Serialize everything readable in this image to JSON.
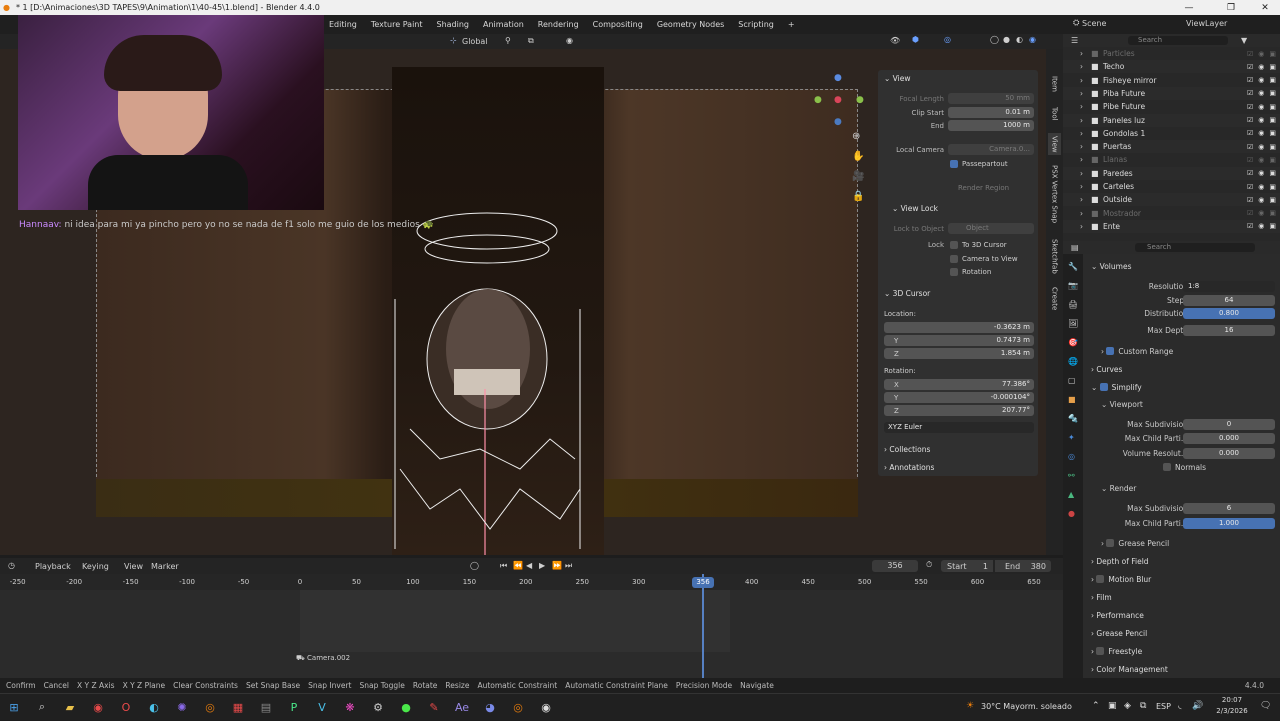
{
  "window": {
    "title": "* 1 [D:\\Animaciones\\3D TAPES\\9\\Animation\\1\\40-45\\1.blend] - Blender 4.4.0"
  },
  "menubar": {
    "workspaces": [
      "Editing",
      "Texture Paint",
      "Shading",
      "Animation",
      "Rendering",
      "Compositing",
      "Geometry Nodes",
      "Scripting"
    ],
    "add": "+"
  },
  "viewport_header": {
    "orientation": "Global"
  },
  "chat": {
    "user": "Hannaav:",
    "message": "ni idea para mi ya pincho pero yo no se nada de f1 solo me guio de los medios",
    "emoji": "🐢"
  },
  "npanel": {
    "view_header": "View",
    "focal_length_label": "Focal Length",
    "focal_length": "50 mm",
    "clip_start_label": "Clip Start",
    "clip_start": "0.01 m",
    "end_label": "End",
    "clip_end": "1000 m",
    "local_camera_label": "Local Camera",
    "local_camera": "Camera.0...",
    "passepartout": "Passepartout",
    "render_region": "Render Region",
    "view_lock_header": "View Lock",
    "lock_to_object_label": "Lock to Object",
    "lock_to_object": "Object",
    "lock_label": "Lock",
    "lock_cursor": "To 3D Cursor",
    "lock_camera": "Camera to View",
    "lock_rotation": "Rotation",
    "cursor_header": "3D Cursor",
    "location_label": "Location:",
    "loc_x": "-0.3623 m",
    "loc_y": "0.7473 m",
    "loc_z": "1.854 m",
    "rotation_label": "Rotation:",
    "rot_x": "77.386°",
    "rot_y": "-0.000104°",
    "rot_z": "207.77°",
    "rot_mode": "XYZ Euler",
    "collections": "Collections",
    "annotations": "Annotations",
    "x": "X",
    "y": "Y",
    "z": "Z"
  },
  "sidetabs": [
    "Item",
    "Tool",
    "View",
    "PSX Vertex Snap",
    "Sketchfab",
    "Create"
  ],
  "outliner": {
    "scene": "Scene",
    "viewlayer": "ViewLayer",
    "search_placeholder": "Search",
    "items": [
      {
        "name": "Particles",
        "dim": true
      },
      {
        "name": "Techo",
        "dim": false
      },
      {
        "name": "Fisheye mirror",
        "dim": false
      },
      {
        "name": "Piba Future",
        "dim": false
      },
      {
        "name": "Pibe Future",
        "dim": false
      },
      {
        "name": "Paneles luz",
        "dim": false
      },
      {
        "name": "Gondolas 1",
        "dim": false
      },
      {
        "name": "Puertas",
        "dim": false
      },
      {
        "name": "Llanas",
        "dim": true
      },
      {
        "name": "Paredes",
        "dim": false
      },
      {
        "name": "Carteles",
        "dim": false
      },
      {
        "name": "Outside",
        "dim": false
      },
      {
        "name": "Mostrador",
        "dim": true
      },
      {
        "name": "Ente",
        "dim": false
      }
    ]
  },
  "props": {
    "search_placeholder": "Search",
    "volumes": "Volumes",
    "resolution_label": "Resolution",
    "resolution": "1:8",
    "steps_label": "Steps",
    "steps": "64",
    "distribution_label": "Distribution",
    "distribution": "0.800",
    "max_depth_label": "Max Depth",
    "max_depth": "16",
    "custom_range": "Custom Range",
    "curves": "Curves",
    "simplify": "Simplify",
    "viewport": "Viewport",
    "max_subdiv_label": "Max Subdivision",
    "max_subdiv_vp": "0",
    "max_child_label": "Max Child Parti...",
    "max_child_vp": "0.000",
    "vol_res_label": "Volume Resolut...",
    "vol_res": "0.000",
    "normals": "Normals",
    "render": "Render",
    "max_subdiv_r": "6",
    "max_child_r": "1.000",
    "grease_pencil_sub": "Grease Pencil",
    "sections": [
      "Depth of Field",
      "Motion Blur",
      "Film",
      "Performance",
      "Grease Pencil",
      "Freestyle",
      "Color Management"
    ]
  },
  "timeline": {
    "menus": [
      "Playback",
      "Keying",
      "View",
      "Marker"
    ],
    "current_frame": "356",
    "start_label": "Start",
    "start": "1",
    "end_label": "End",
    "end": "380",
    "ticks": [
      "-250",
      "-200",
      "-150",
      "-100",
      "-50",
      "0",
      "50",
      "100",
      "150",
      "200",
      "250",
      "300",
      "356",
      "400",
      "450",
      "500",
      "550",
      "600",
      "650"
    ],
    "camera_marker": "Camera.002"
  },
  "status": {
    "items": [
      "Confirm",
      "Cancel",
      "X Y Z Axis",
      "X Y Z Plane",
      "Clear Constraints",
      "Set Snap Base",
      "Snap Invert",
      "Snap Toggle",
      "Rotate",
      "Resize",
      "Automatic Constraint",
      "Automatic Constraint Plane",
      "Precision Mode",
      "Navigate"
    ],
    "version": "4.4.0"
  },
  "taskbar": {
    "weather": "30°C  Mayorm. soleado",
    "lang": "ESP",
    "time": "20:07",
    "date": "2/3/2026"
  }
}
